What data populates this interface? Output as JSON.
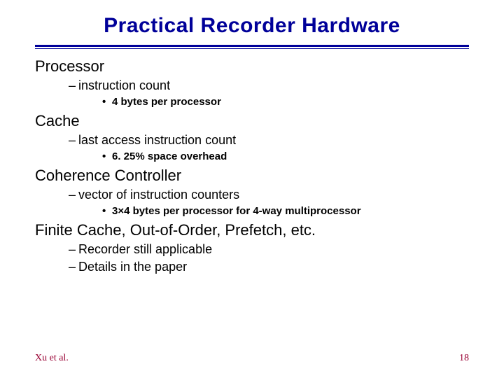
{
  "title": "Practical Recorder Hardware",
  "sections": {
    "processor": {
      "heading": "Processor",
      "sub1": "instruction count",
      "sub1_detail": "4 bytes per processor"
    },
    "cache": {
      "heading": "Cache",
      "sub1": "last access instruction count",
      "sub1_detail": "6. 25% space overhead"
    },
    "coherence": {
      "heading": "Coherence Controller",
      "sub1": "vector of instruction counters",
      "sub1_detail": "3×4 bytes per processor for 4-way multiprocessor"
    },
    "finite": {
      "heading": "Finite Cache, Out-of-Order, Prefetch, etc.",
      "sub1": "Recorder still applicable",
      "sub2": "Details in the paper"
    }
  },
  "footer": {
    "left": "Xu et al.",
    "right": "18"
  },
  "bullets": {
    "dash": "–",
    "dot": "•"
  }
}
